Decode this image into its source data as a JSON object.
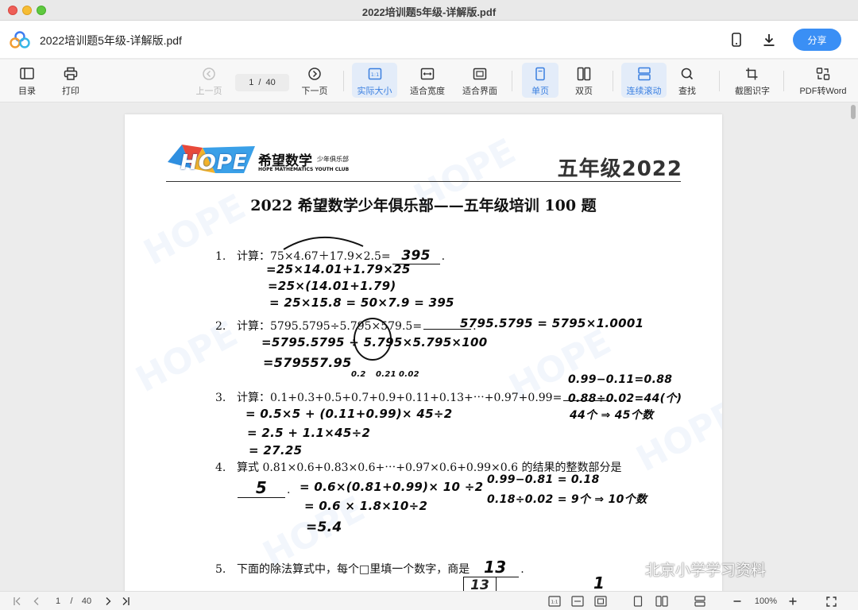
{
  "window": {
    "title": "2022培训题5年级-详解版.pdf"
  },
  "header": {
    "filename": "2022培训题5年级-详解版.pdf",
    "share_label": "分享"
  },
  "toolbar": {
    "toc": "目录",
    "print": "打印",
    "prev": "上一页",
    "current_page": "1",
    "page_sep": "/",
    "total_pages": "40",
    "next": "下一页",
    "actual_size": "实际大小",
    "fit_width": "适合宽度",
    "fit_page": "适合界面",
    "single": "单页",
    "double": "双页",
    "continuous": "连续滚动",
    "find": "查找",
    "ocr": "截图识字",
    "pdf_to_word": "PDF转Word"
  },
  "doc": {
    "brand": "HOPE",
    "brand_cn": "希望数学",
    "brand_sub": "少年俱乐部",
    "brand_en": "HOPE MATHEMATICS YOUTH CLUB",
    "grade": "五年级2022",
    "title": "2022 希望数学少年俱乐部——五年级培训 100 题",
    "questions": [
      {
        "num": "1.",
        "pre": "计算：75×4.67＋17.9×2.5=",
        "answer": "395",
        "post": "."
      },
      {
        "num": "2.",
        "pre": "计算：5795.5795÷5.795×579.5=",
        "answer": "",
        "post": "."
      },
      {
        "num": "3.",
        "pre": "计算：0.1+0.3+0.5+0.7+0.9+0.11+0.13+⋯+0.97+0.99=",
        "answer": "",
        "post": "."
      },
      {
        "num": "4.",
        "pre": "算式 0.81×0.6+0.83×0.6+⋯+0.97×0.6+0.99×0.6 的结果的整数部分是",
        "answer": "5",
        "post": "."
      },
      {
        "num": "5.",
        "pre": "下面的除法算式中，每个□里填一个数字，商是",
        "answer": "13",
        "post": "."
      }
    ],
    "handwriting": {
      "q1": [
        "=25×14.01+1.79×25",
        "=25×(14.01+1.79)",
        "= 25×15.8 = 50×7.9 = 395"
      ],
      "q2_side": "5795.5795 = 5795×1.0001",
      "q2": [
        "=5795.5795 ÷ 5.795×5.795×100",
        "=579557.95"
      ],
      "q3_top": [
        "0.2",
        "0.21",
        "0.02"
      ],
      "q3_side": [
        "0.99−0.11=0.88",
        "0.88÷0.02=44(个)",
        "44个 ⇒ 45个数"
      ],
      "q3": [
        "= 0.5×5 + (0.11+0.99)× 45÷2",
        "= 2.5 + 1.1×45÷2",
        "= 27.25"
      ],
      "q4": [
        "= 0.6×(0.81+0.99)× 10 ÷2",
        "= 0.6 × 1.8×10÷2",
        "=5.4"
      ],
      "q4_side": [
        "0.99−0.81 = 0.18",
        "0.18÷0.02 = 9个 ⇒ 10个数"
      ],
      "q5_box": "13",
      "q5_mark": "1"
    }
  },
  "watermark": {
    "text": "北京小学学习资料"
  },
  "statusbar": {
    "current_page": "1",
    "page_sep": "/",
    "total_pages": "40",
    "zoom": "100%"
  }
}
